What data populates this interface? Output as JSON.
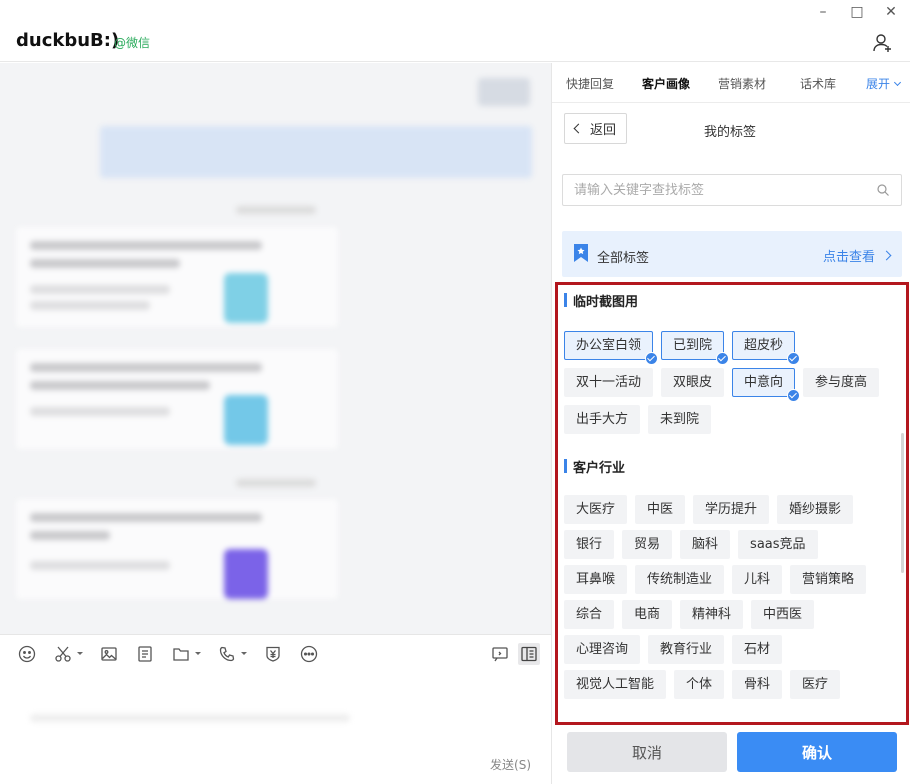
{
  "window": {
    "minimize_glyph": "–",
    "maximize_glyph": "□",
    "close_glyph": "✕"
  },
  "header": {
    "contact_name": "duckbuB:)",
    "contact_source": "@微信",
    "add_contact_icon": "user-plus-icon"
  },
  "toolbar": {
    "icons": [
      "emoji-icon",
      "scissors-icon",
      "image-icon",
      "document-icon",
      "folder-icon",
      "phone-icon",
      "payment-icon",
      "more-icon"
    ],
    "right_icons": [
      "chat-history-icon",
      "side-panel-icon"
    ],
    "send_label": "发送(S)"
  },
  "panel": {
    "tabs": [
      {
        "label": "快捷回复",
        "active": false
      },
      {
        "label": "客户画像",
        "active": true
      },
      {
        "label": "营销素材",
        "active": false
      },
      {
        "label": "话术库",
        "active": false
      }
    ],
    "expand_label": "展开",
    "back_label": "返回",
    "title": "我的标签",
    "search_placeholder": "请输入关键字查找标签",
    "all_tags_label": "全部标签",
    "view_label": "点击查看",
    "sections": [
      {
        "title": "临时截图用",
        "tags": [
          {
            "label": "办公室白领",
            "selected": true
          },
          {
            "label": "已到院",
            "selected": true
          },
          {
            "label": "超皮秒",
            "selected": true
          },
          {
            "label": "双十一活动",
            "selected": false
          },
          {
            "label": "双眼皮",
            "selected": false
          },
          {
            "label": "中意向",
            "selected": true
          },
          {
            "label": "参与度高",
            "selected": false
          },
          {
            "label": "出手大方",
            "selected": false
          },
          {
            "label": "未到院",
            "selected": false
          }
        ]
      },
      {
        "title": "客户行业",
        "tags": [
          {
            "label": "大医疗",
            "selected": false
          },
          {
            "label": "中医",
            "selected": false
          },
          {
            "label": "学历提升",
            "selected": false
          },
          {
            "label": "婚纱摄影",
            "selected": false
          },
          {
            "label": "银行",
            "selected": false
          },
          {
            "label": "贸易",
            "selected": false
          },
          {
            "label": "脑科",
            "selected": false
          },
          {
            "label": "saas竞品",
            "selected": false
          },
          {
            "label": "耳鼻喉",
            "selected": false
          },
          {
            "label": "传统制造业",
            "selected": false
          },
          {
            "label": "儿科",
            "selected": false
          },
          {
            "label": "营销策略",
            "selected": false
          },
          {
            "label": "综合",
            "selected": false
          },
          {
            "label": "电商",
            "selected": false
          },
          {
            "label": "精神科",
            "selected": false
          },
          {
            "label": "中西医",
            "selected": false
          },
          {
            "label": "心理咨询",
            "selected": false
          },
          {
            "label": "教育行业",
            "selected": false
          },
          {
            "label": "石材",
            "selected": false
          },
          {
            "label": "视觉人工智能",
            "selected": false
          },
          {
            "label": "个体",
            "selected": false
          },
          {
            "label": "骨科",
            "selected": false
          },
          {
            "label": "医疗",
            "selected": false
          }
        ]
      }
    ],
    "cancel_label": "取消",
    "confirm_label": "确认"
  },
  "colors": {
    "accent": "#3b84e8",
    "highlight_border": "#b3171e",
    "contact_source": "#2bab5c",
    "confirm_bg": "#3a8cf4"
  }
}
